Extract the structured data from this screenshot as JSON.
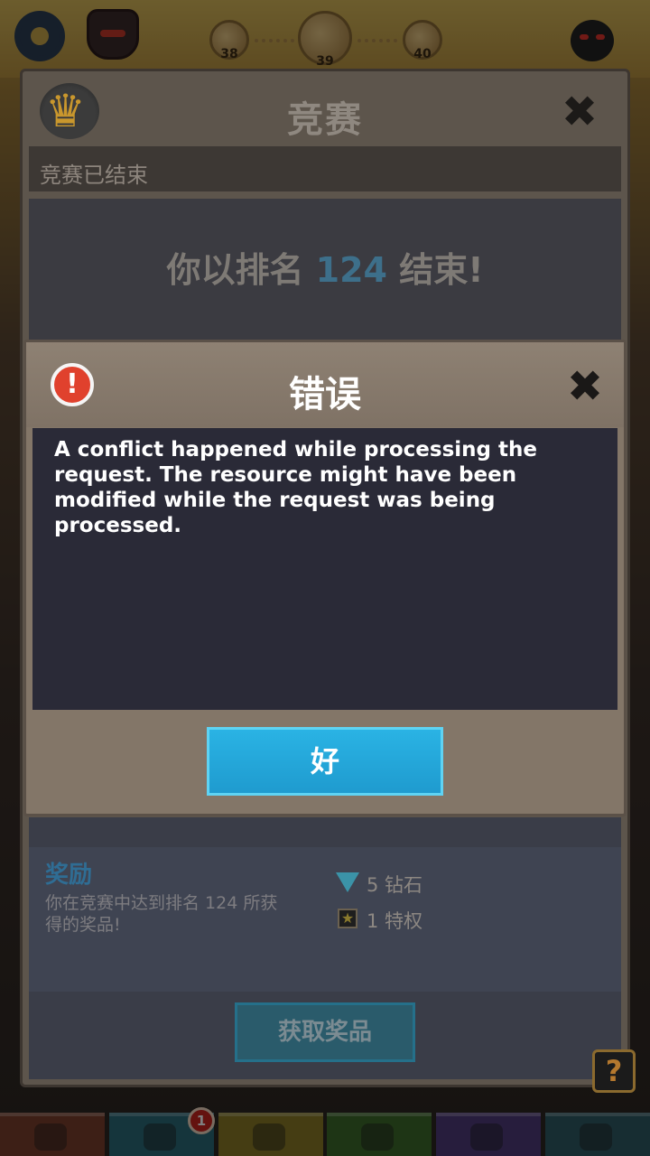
{
  "hud": {
    "levels": [
      "38",
      "39",
      "40"
    ]
  },
  "tournament": {
    "title": "竞赛",
    "status": "竞赛已结束",
    "rank_prefix": "你以排名 ",
    "rank_value": "124",
    "rank_suffix": " 结束!",
    "reward_title": "奖励",
    "reward_desc": "你在竞赛中达到排名 124 所获得的奖品!",
    "rewards": [
      {
        "icon": "diamond-icon",
        "text": "5 钻石"
      },
      {
        "icon": "star-icon",
        "text": "1 特权"
      }
    ],
    "claim_label": "获取奖品",
    "help_label": "?"
  },
  "error_dialog": {
    "title": "错误",
    "icon_glyph": "!",
    "message": "A conflict happened while processing the request.  The resource might have been modified while the request was being processed.",
    "ok_label": "好",
    "close_glyph": "✖"
  },
  "bottom_nav": {
    "badge_count": "1",
    "colors": [
      "#7a3e2c",
      "#2a6a78",
      "#8a7b26",
      "#3d6a2a",
      "#4e3a7a",
      "#2e5a64"
    ]
  }
}
